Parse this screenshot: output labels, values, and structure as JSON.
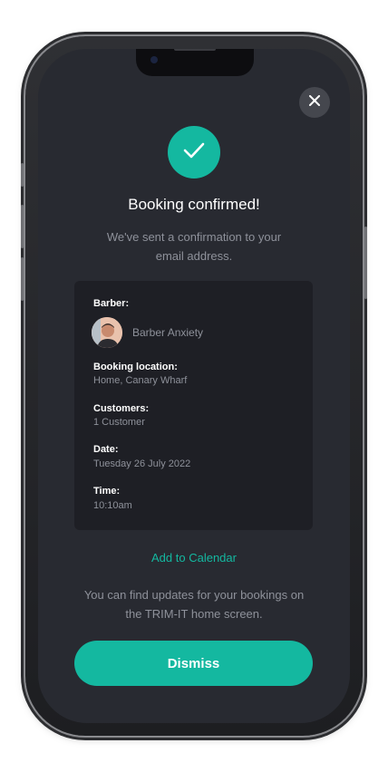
{
  "modal": {
    "title": "Booking confirmed!",
    "subtitle": "We've sent a confirmation to your email address.",
    "close_icon": "close-icon",
    "success_icon": "checkmark-icon",
    "accent_color": "#14b8a0"
  },
  "details": {
    "barber_label": "Barber:",
    "barber_name": "Barber Anxiety",
    "location_label": "Booking location:",
    "location_value": "Home, Canary Wharf",
    "customers_label": "Customers:",
    "customers_value": "1 Customer",
    "date_label": "Date:",
    "date_value": "Tuesday 26 July 2022",
    "time_label": "Time:",
    "time_value": "10:10am"
  },
  "actions": {
    "calendar_link": "Add to Calendar",
    "updates_text": "You can find updates for your bookings on the TRIM-IT home screen.",
    "dismiss_label": "Dismiss"
  }
}
